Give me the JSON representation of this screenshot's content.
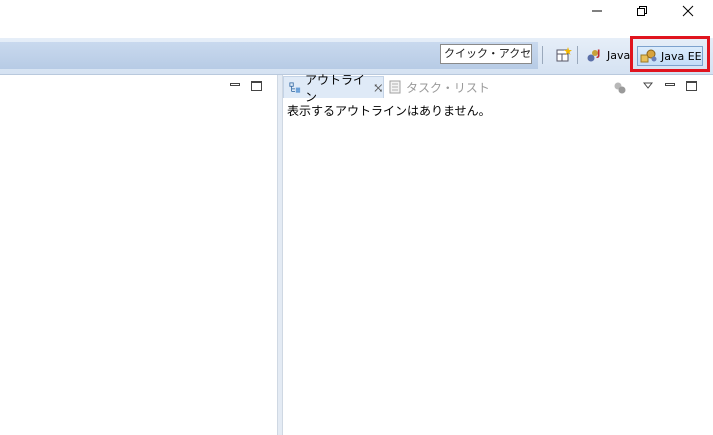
{
  "window": {
    "controls": {
      "minimize_icon": "minimize-icon",
      "restore_icon": "restore-icon",
      "close_icon": "close-icon"
    }
  },
  "toolbar": {
    "quick_access_placeholder": "クイック・アクセス",
    "perspectives": [
      {
        "label": "Java",
        "icon": "java-perspective-icon"
      },
      {
        "label": "Java EE",
        "icon": "javaee-perspective-icon",
        "active": true
      }
    ],
    "highlight_color": "#e0141e"
  },
  "outline_view": {
    "tabs": [
      {
        "label": "アウトライン",
        "active": true
      },
      {
        "label": "タスク・リスト",
        "active": false
      }
    ],
    "empty_message": "表示するアウトラインはありません。"
  },
  "colors": {
    "toolbar_bg": "#c9d9ee",
    "active_tab_bg": "#dfeaf7",
    "inactive_text": "#9a9a9a"
  }
}
